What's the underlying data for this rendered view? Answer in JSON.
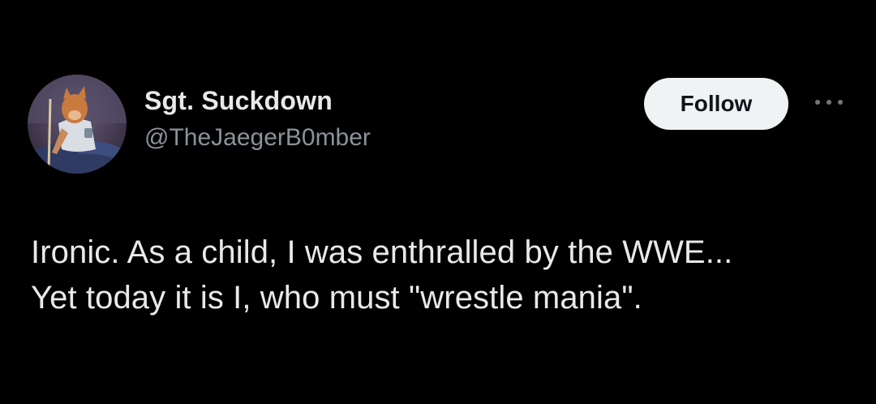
{
  "colors": {
    "background": "#000000",
    "text_primary": "#e7e9ea",
    "text_secondary": "#8b9299",
    "follow_button_bg": "#eff3f4",
    "follow_button_text": "#0f1419"
  },
  "author": {
    "avatar_icon": "user-avatar",
    "display_name": "Sgt. Suckdown",
    "handle": "@TheJaegerB0mber"
  },
  "actions": {
    "follow_label": "Follow",
    "more_icon": "more-dots-icon"
  },
  "tweet": {
    "lines": [
      "Ironic. As a child, I was enthralled by the WWE...",
      "Yet today it is I, who must \"wrestle mania\"."
    ]
  }
}
